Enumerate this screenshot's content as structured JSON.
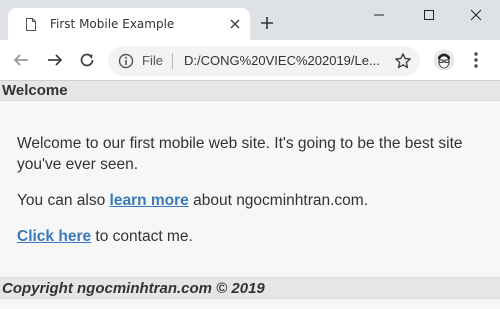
{
  "browser": {
    "tab_title": "First Mobile Example",
    "omnibox": {
      "scheme_label": "File",
      "url": "D:/CONG%20VIEC%202019/Le..."
    }
  },
  "page": {
    "header": "Welcome",
    "intro": "Welcome to our first mobile web site. It's going to be the best site you've ever seen.",
    "learn_prefix": "You can also",
    "learn_link": "learn more",
    "learn_suffix": "about ngocminhtran.com.",
    "contact_link": "Click here",
    "contact_suffix": "to contact me.",
    "footer": "Copyright ngocminhtran.com © 2019"
  },
  "colors": {
    "titlebar": "#dee1e6",
    "link": "#3a7ab8",
    "page_header_bg": "#e6e6e6"
  }
}
